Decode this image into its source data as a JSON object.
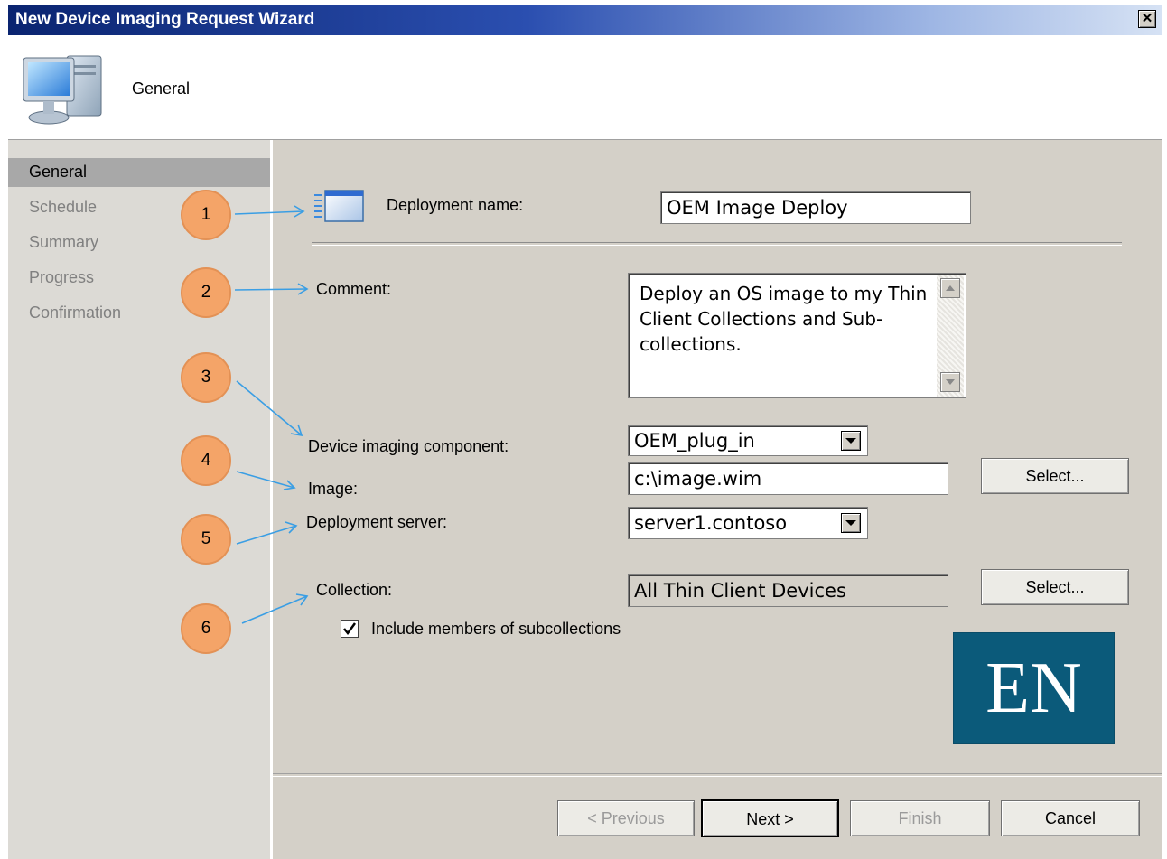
{
  "window": {
    "title": "New Device Imaging Request Wizard",
    "close_glyph": "✕"
  },
  "header": {
    "title": "General",
    "icon": "computer-icon"
  },
  "sidebar": {
    "items": [
      {
        "label": "General",
        "selected": true
      },
      {
        "label": "Schedule",
        "selected": false
      },
      {
        "label": "Summary",
        "selected": false
      },
      {
        "label": "Progress",
        "selected": false
      },
      {
        "label": "Confirmation",
        "selected": false
      }
    ]
  },
  "callouts": [
    "1",
    "2",
    "3",
    "4",
    "5",
    "6"
  ],
  "form": {
    "deployment_name": {
      "label": "Deployment name:",
      "value": "OEM Image Deploy"
    },
    "comment": {
      "label": "Comment:",
      "value": "Deploy an OS image to my Thin Client Collections and Sub-collections."
    },
    "component": {
      "label": "Device imaging component:",
      "value": "OEM_plug_in"
    },
    "image": {
      "label": "Image:",
      "value": "c:\\image.wim",
      "button": "Select..."
    },
    "server": {
      "label": "Deployment server:",
      "value": "server1.contoso"
    },
    "collection": {
      "label": "Collection:",
      "value": "All Thin Client  Devices",
      "button": "Select..."
    },
    "include_sub": {
      "label": "Include members of subcollections",
      "checked": true
    }
  },
  "logo": {
    "text": "EN",
    "color": "#0b5a7a"
  },
  "buttons": {
    "previous": "< Previous",
    "next": "Next >",
    "finish": "Finish",
    "cancel": "Cancel"
  },
  "colors": {
    "callout": "#f4a468",
    "arrow": "#3a9ee4"
  }
}
